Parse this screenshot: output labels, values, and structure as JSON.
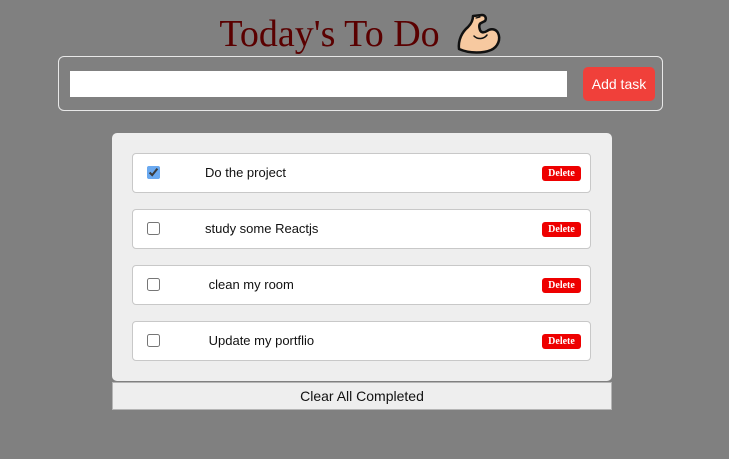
{
  "header": {
    "title": "Today's To Do",
    "icon": "flexed-biceps-icon"
  },
  "new_task": {
    "value": "",
    "placeholder": "",
    "add_label": "Add task"
  },
  "tasks": [
    {
      "text": "Do the project",
      "completed": true,
      "delete_label": "Delete"
    },
    {
      "text": "study some Reactjs",
      "completed": false,
      "delete_label": "Delete"
    },
    {
      "text": " clean my room",
      "completed": false,
      "delete_label": "Delete"
    },
    {
      "text": " Update my portflio",
      "completed": false,
      "delete_label": "Delete"
    }
  ],
  "clear_completed_label": "Clear All Completed",
  "colors": {
    "background": "#808080",
    "title": "#5a0000",
    "add_button": "#f0403a",
    "delete_button": "#ee0000"
  }
}
